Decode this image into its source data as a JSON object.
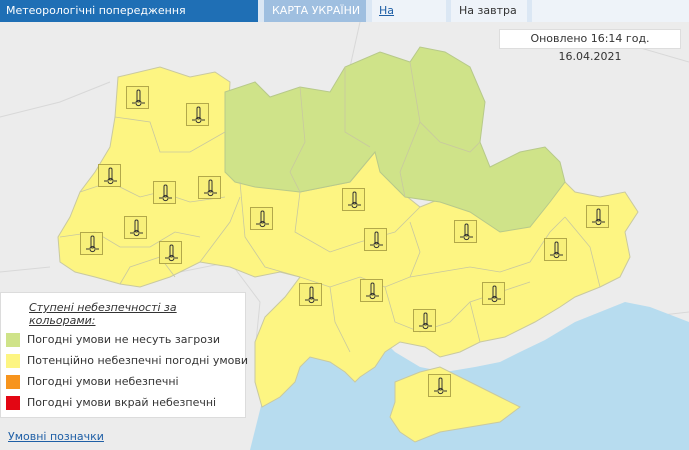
{
  "header": {
    "title": "Метеорологічні попередження",
    "tabs": [
      {
        "label": "КАРТА УКРАЇНИ",
        "arrow": "▸"
      },
      {
        "label": "На сьогодні"
      },
      {
        "label": "На завтра"
      }
    ]
  },
  "map": {
    "updated_text": "Оновлено 16:14 год. 16.04.2021",
    "icon_name": "thermometer-frost-icon",
    "colors": {
      "safe": "#cfe389",
      "potential": "#fdf582",
      "dangerous": "#f7941d",
      "extreme": "#e30613",
      "water": "#b7dcef",
      "neighbors": "#ececec"
    },
    "region_warnings": [
      "potential",
      "potential",
      "potential",
      "potential",
      "potential",
      "potential",
      "potential",
      "potential",
      "potential",
      "potential",
      "potential",
      "potential",
      "potential",
      "potential",
      "potential",
      "potential",
      "potential",
      "potential"
    ]
  },
  "legend": {
    "title": "Ступені небезпечності за кольорами:",
    "items": [
      {
        "label": "Погодні умови не несуть загрози",
        "level": "safe"
      },
      {
        "label": "Потенційно небезпечні погодні умови",
        "level": "potential"
      },
      {
        "label": "Погодні умови небезпечні",
        "level": "dangerous"
      },
      {
        "label": "Погодні умови вкрай небезпечні",
        "level": "extreme"
      }
    ]
  },
  "footer": {
    "link": "Умовні позначки"
  }
}
